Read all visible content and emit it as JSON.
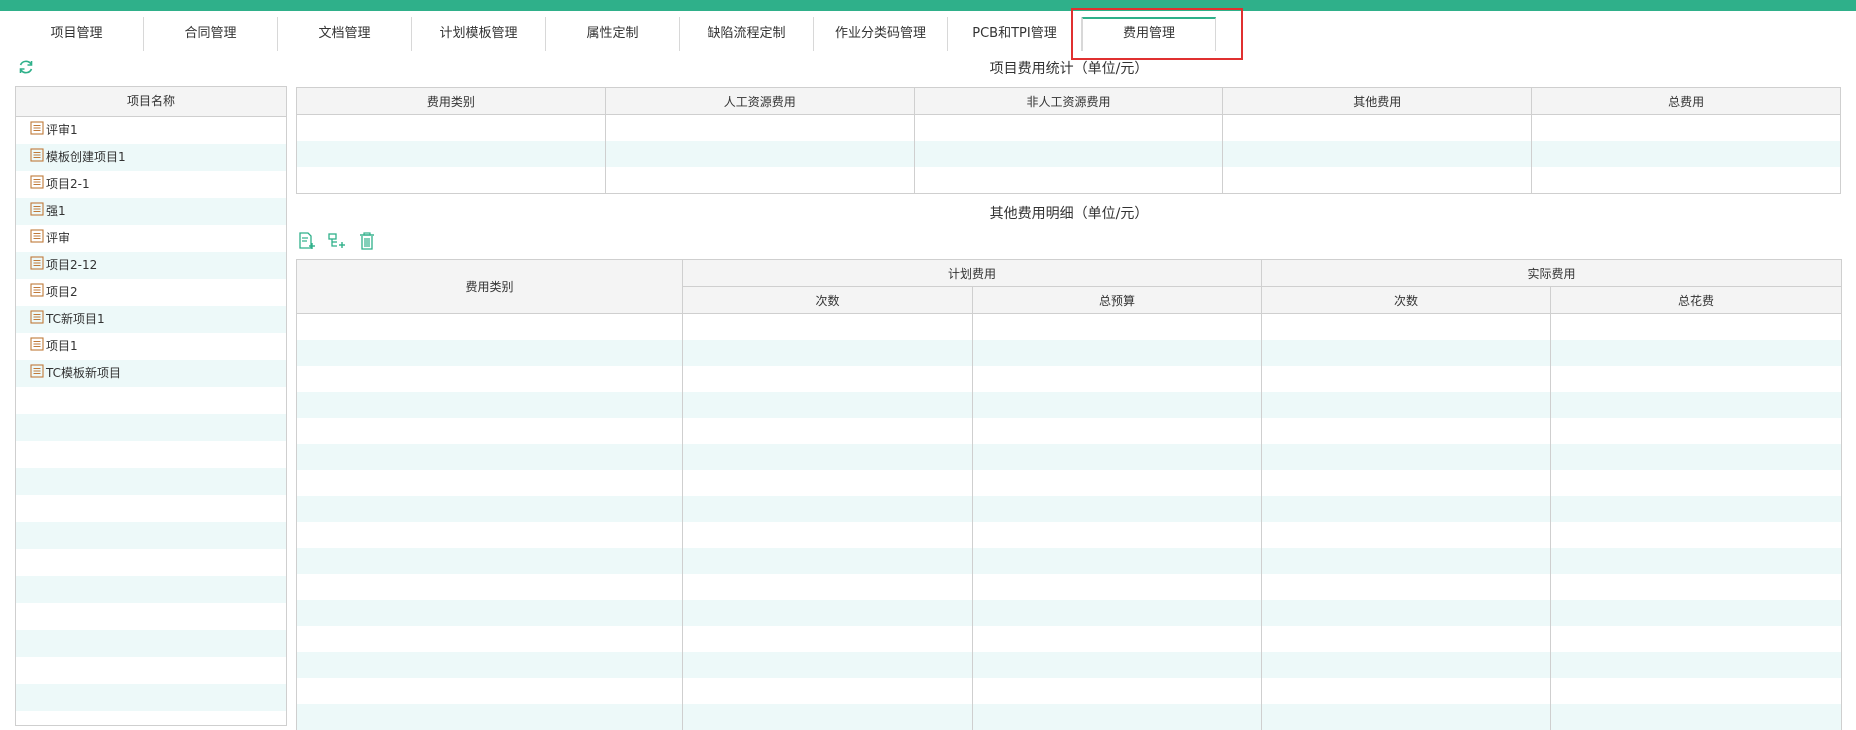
{
  "tabs": [
    "项目管理",
    "合同管理",
    "文档管理",
    "计划模板管理",
    "属性定制",
    "缺陷流程定制",
    "作业分类码管理",
    "PCB和TPI管理",
    "费用管理"
  ],
  "active_tab": "费用管理",
  "project_tree": {
    "header": "项目名称",
    "items": [
      "评审1",
      "模板创建项目1",
      "项目2-1",
      "强1",
      "评审",
      "项目2-12",
      "项目2",
      "TC新项目1",
      "项目1",
      "TC模板新项目"
    ]
  },
  "summary": {
    "title": "项目费用统计（单位/元）",
    "columns": [
      "费用类别",
      "人工资源费用",
      "非人工资源费用",
      "其他费用",
      "总费用"
    ]
  },
  "detail": {
    "title": "其他费用明细（单位/元）",
    "col_category": "费用类别",
    "group_planned": "计划费用",
    "group_actual": "实际费用",
    "planned_count": "次数",
    "planned_total": "总预算",
    "actual_count": "次数",
    "actual_total": "总花费"
  },
  "colors": {
    "accent": "#2fb08a",
    "highlight_box": "#e03030",
    "stripe": "#edf9f9"
  }
}
